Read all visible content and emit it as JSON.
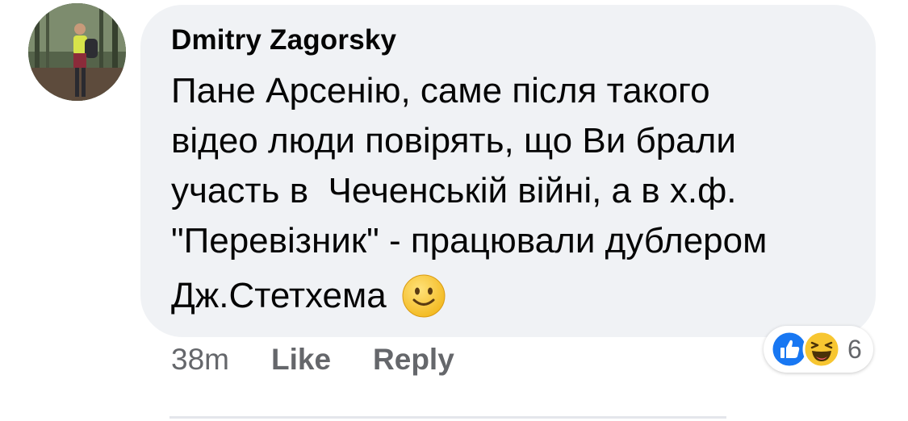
{
  "comment": {
    "author": "Dmitry Zagorsky",
    "text_lines": [
      "Пане Арсенію, саме після такого",
      "відео люди повірять, що Ви брали",
      "участь в  Чеченській війні, а в х.ф.",
      "\"Перевізник\" - працювали дублером",
      "Дж.Стетхема"
    ],
    "emoji": "slightly-smiling-face"
  },
  "actions": {
    "time": "38m",
    "like_label": "Like",
    "reply_label": "Reply"
  },
  "reactions": {
    "types": [
      "like",
      "haha"
    ],
    "count": "6"
  },
  "colors": {
    "bubble": "#f0f2f5",
    "text": "#050505",
    "meta": "#65676b",
    "like_blue": "#1877f2",
    "emoji_yellow": "#f7c631"
  }
}
